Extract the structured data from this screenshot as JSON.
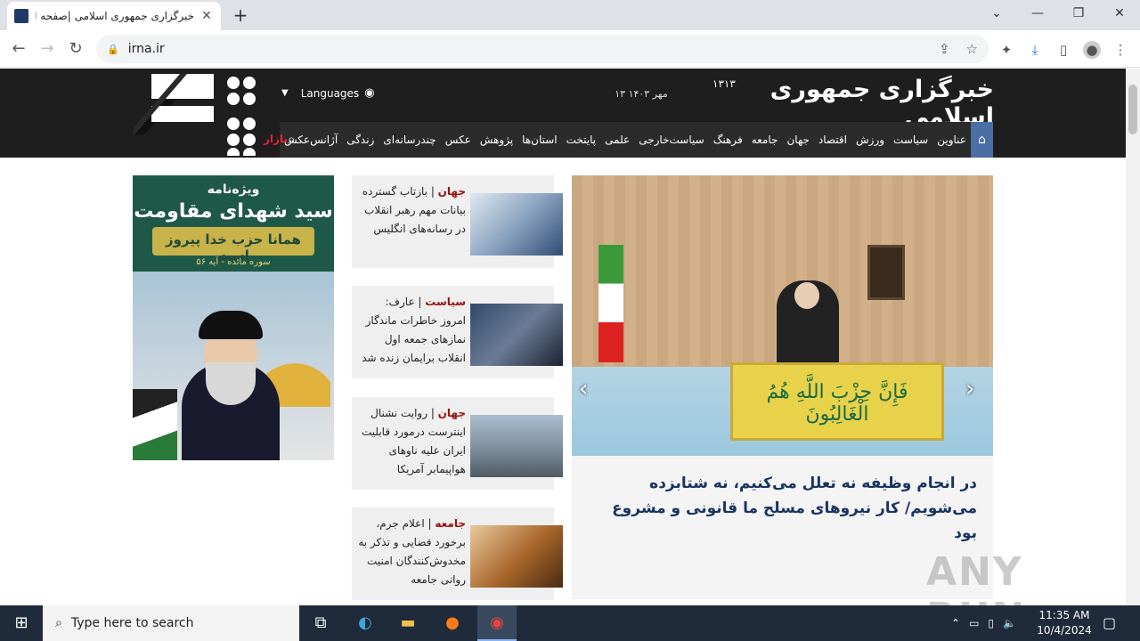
{
  "browser": {
    "tab_title": "خبرگزاری جمهوری اسلامی |صفحه اص",
    "tab_close": "✕",
    "new_tab": "+",
    "url": "irna.ir",
    "window_minimize": "—",
    "window_restore": "❐",
    "window_close": "✕",
    "window_dropdown": "⌄"
  },
  "header": {
    "site_title": "خبرگزاری جمهوری اسلامی",
    "site_year": "۱۳۱۳",
    "date": "۱۳ مهر ۱۴۰۳",
    "languages": "Languages",
    "nav_items": [
      "عناوین",
      "سیاست",
      "ورزش",
      "اقتصاد",
      "جهان",
      "جامعه",
      "فرهنگ",
      "سیاست‌خارجی",
      "علمی",
      "پایتخت",
      "استان‌ها",
      "پژوهش",
      "عکس",
      "چندرسانه‌ای",
      "زندگی",
      "آژانس‌عکس"
    ],
    "bazaar": "بازار"
  },
  "hero": {
    "podium_text": "فَإِنَّ حِزْبَ اللَّهِ هُمُ الْغَالِبُونَ",
    "title": "در انجام وظیفه نه تعلل می‌کنیم، نه شتابزده می‌شویم/ کار نیروهای مسلح ما قانونی و مشروع بود"
  },
  "news": [
    {
      "category": "جهان",
      "text": "بازتاب گسترده بیانات مهم رهبر انقلاب در رسانه‌های انگلیس"
    },
    {
      "category": "سیاست",
      "text": "عارف: امروز خاطرات ماندگار نمازهای جمعه اول انقلاب برایمان زنده شد"
    },
    {
      "category": "جهان",
      "text": "روایت نشنال اینترست درمورد قابلیت ایران علیه ناوهای هواپیمابر آمریکا"
    },
    {
      "category": "جامعه",
      "text": "اعلام جرم، برخورد قضایی و تذکر به مخدوش‌کنندگان امنیت روانی جامعه"
    }
  ],
  "ad": {
    "line1": "ویژه‌نامه",
    "line2": "سید شهدای مقاومت",
    "line3": "همانا حزب خدا پیروز است",
    "line4": "سوره مائده - آیه ۵۶"
  },
  "watermark": "ANY RUN",
  "taskbar": {
    "search_placeholder": "Type here to search",
    "time": "11:35 AM",
    "date": "10/4/2024"
  }
}
